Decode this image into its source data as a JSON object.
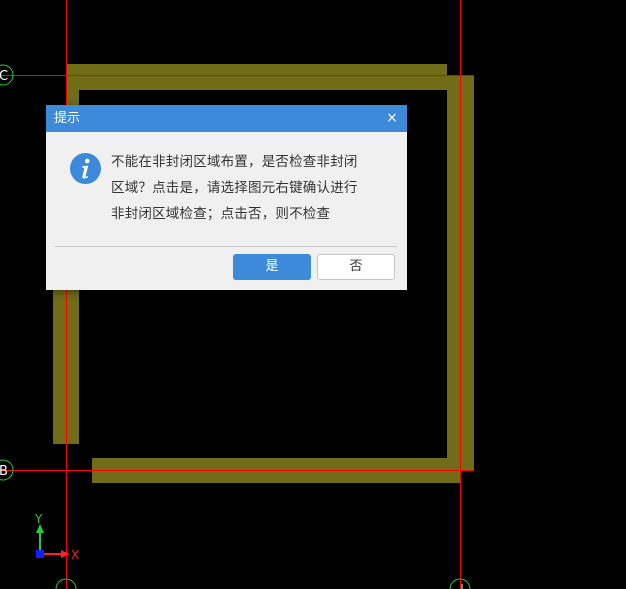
{
  "canvas": {
    "background": "#000000",
    "wall_color": "#706c18",
    "grid_line_color": "#ff0000",
    "axis_markers": [
      "C",
      "B"
    ],
    "ucs_icon": {
      "y_label": "Y",
      "x_label": "X",
      "y_color": "#2ecc2e",
      "x_color": "#ff2020",
      "origin_color": "#1020ff"
    }
  },
  "dialog": {
    "title": "提示",
    "close_symbol": "×",
    "icon": "info-icon",
    "accent": "#3c8ad9",
    "message_lines": [
      "不能在非封闭区域布置，是否检查非封闭",
      "区域？点击是，请选择图元右键确认进行",
      "非封闭区域检查；点击否，则不检查"
    ],
    "yes_label": "是",
    "no_label": "否"
  }
}
